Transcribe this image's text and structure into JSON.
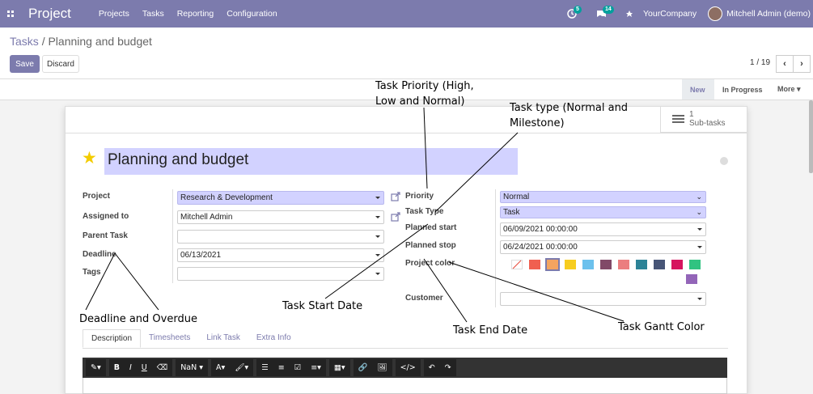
{
  "topbar": {
    "app_name": "Project",
    "menu": [
      "Projects",
      "Tasks",
      "Reporting",
      "Configuration"
    ],
    "activity_count": "5",
    "messages_count": "14",
    "company": "YourCompany",
    "user": "Mitchell Admin (demo)"
  },
  "breadcrumb": {
    "parent": "Tasks",
    "separator": "/",
    "current": "Planning and budget"
  },
  "buttons": {
    "save": "Save",
    "discard": "Discard"
  },
  "pager": {
    "label": "1 / 19",
    "prev": "‹",
    "next": "›"
  },
  "statusbar": {
    "stages": [
      "New",
      "In Progress",
      "More ▾"
    ],
    "active": "New"
  },
  "smart_button": {
    "count": "1",
    "label": "Sub-tasks"
  },
  "task": {
    "title": "Planning and budget"
  },
  "left_fields": {
    "project_label": "Project",
    "project_value": "Research & Development",
    "assigned_label": "Assigned to",
    "assigned_value": "Mitchell Admin",
    "parent_label": "Parent Task",
    "parent_value": "",
    "deadline_label": "Deadline",
    "deadline_value": "06/13/2021",
    "tags_label": "Tags",
    "tags_value": ""
  },
  "right_fields": {
    "priority_label": "Priority",
    "priority_value": "Normal",
    "type_label": "Task Type",
    "type_value": "Task",
    "start_label": "Planned start",
    "start_value": "06/09/2021 00:00:00",
    "stop_label": "Planned stop",
    "stop_value": "06/24/2021 00:00:00",
    "color_label": "Project color",
    "customer_label": "Customer",
    "customer_value": ""
  },
  "colors": [
    "#f06050",
    "#f4a460",
    "#f7cd1f",
    "#6cc1ed",
    "#814968",
    "#eb7e7f",
    "#2c8397",
    "#475577",
    "#d6145f",
    "#30c381",
    "#9365b8"
  ],
  "tabs": [
    "Description",
    "Timesheets",
    "Link Task",
    "Extra Info"
  ],
  "editor_toolbar": [
    "✎▾",
    "B",
    "I",
    "U",
    "⌫",
    "NaN ▾",
    "A▾",
    "🖌▾",
    "☰",
    "≡",
    "☑",
    "≡▾",
    "▦▾",
    "🔗",
    "🖼",
    "</>",
    "↶",
    "↷"
  ],
  "annotations": {
    "priority": "Task Priority (High,\nLow and Normal)",
    "type": "Task type (Normal and\nMilestone)",
    "deadline": "Deadline and Overdue",
    "start": "Task Start Date",
    "end": "Task End Date",
    "gantt": "Task Gantt Color"
  }
}
